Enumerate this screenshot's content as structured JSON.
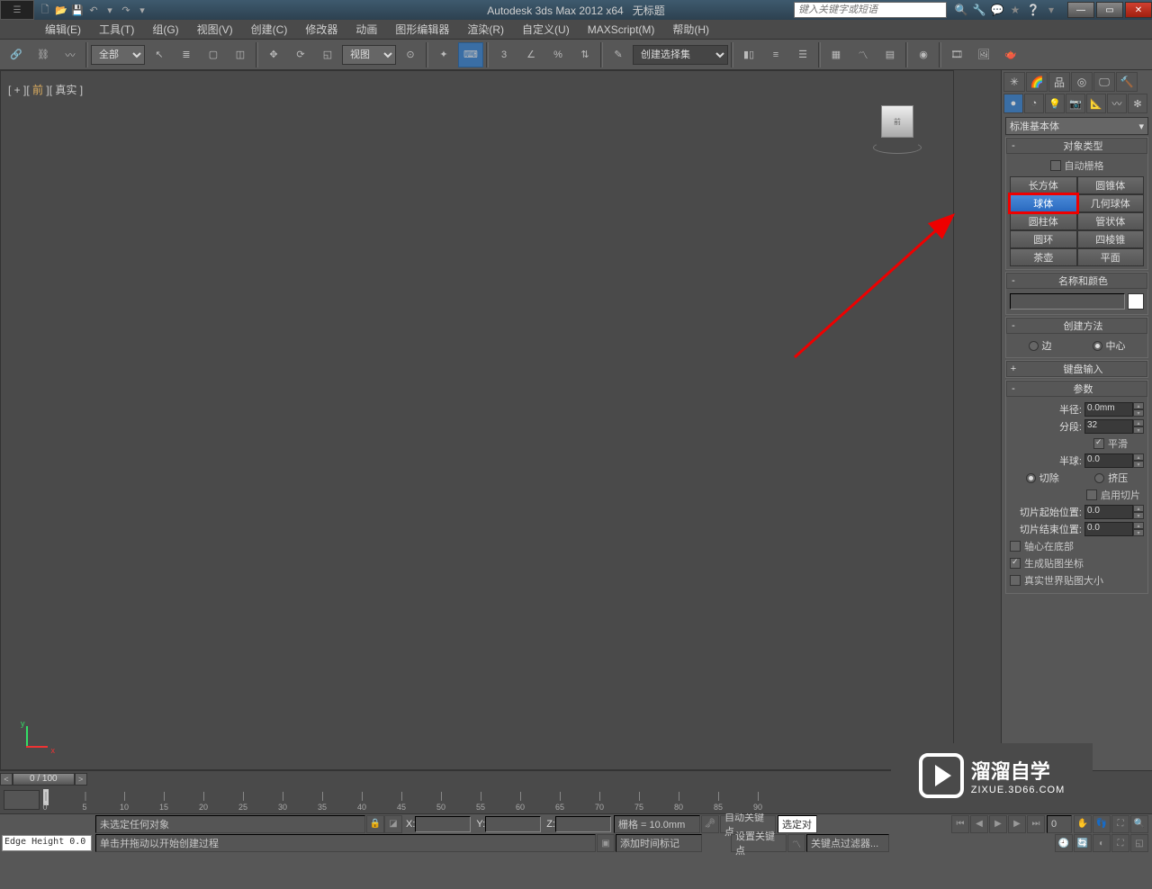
{
  "title": {
    "app": "Autodesk 3ds Max  2012 x64",
    "doc": "无标题"
  },
  "search_placeholder": "键入关键字或短语",
  "menu": [
    "编辑(E)",
    "工具(T)",
    "组(G)",
    "视图(V)",
    "创建(C)",
    "修改器",
    "动画",
    "图形编辑器",
    "渲染(R)",
    "自定义(U)",
    "MAXScript(M)",
    "帮助(H)"
  ],
  "toolbar": {
    "filter": "全部",
    "viewproj": "视图",
    "named_sel": "创建选择集"
  },
  "viewport": {
    "label_prefix": "[ + ][ ",
    "front": "前",
    "label_suffix": " ][ 真实 ]",
    "cube_face": "前"
  },
  "cmd": {
    "primitive_dd": "标准基本体",
    "obj_type_hdr": "对象类型",
    "autogrid": "自动栅格",
    "objects": [
      "长方体",
      "圆锥体",
      "球体",
      "几何球体",
      "圆柱体",
      "管状体",
      "圆环",
      "四棱锥",
      "茶壶",
      "平面"
    ],
    "selected_obj": "球体",
    "name_color_hdr": "名称和颜色",
    "create_method_hdr": "创建方法",
    "cm_edge": "边",
    "cm_center": "中心",
    "kb_hdr": "键盘输入",
    "params_hdr": "参数",
    "radius_lbl": "半径:",
    "radius_val": "0.0mm",
    "segs_lbl": "分段:",
    "segs_val": "32",
    "smooth": "平滑",
    "hemi_lbl": "半球:",
    "hemi_val": "0.0",
    "chop": "切除",
    "squash": "挤压",
    "slice_on": "启用切片",
    "slice_from_lbl": "切片起始位置:",
    "slice_from_val": "0.0",
    "slice_to_lbl": "切片结束位置:",
    "slice_to_val": "0.0",
    "base_pivot": "轴心在底部",
    "gen_uv": "生成贴图坐标",
    "real_world": "真实世界贴图大小"
  },
  "timeline": {
    "pos": "0 / 100",
    "ticks": [
      0,
      5,
      10,
      15,
      20,
      25,
      30,
      35,
      40,
      45,
      50,
      55,
      60,
      65,
      70,
      75,
      80,
      85,
      90
    ]
  },
  "status": {
    "sel": "未选定任何对象",
    "prompt": "单击并拖动以开始创建过程",
    "grid": "栅格 = 10.0mm",
    "autokey": "自动关键点",
    "selkey": "选定对",
    "setkey": "设置关键点",
    "keyfilter": "关键点过滤器...",
    "add_time_tag": "添加时间标记",
    "frame": "0",
    "coord_x": "X:",
    "coord_y": "Y:",
    "coord_z": "Z:",
    "edge_height": "Edge Height 0.0"
  },
  "watermark": {
    "name": "溜溜自学",
    "url": "ZIXUE.3D66.COM"
  }
}
